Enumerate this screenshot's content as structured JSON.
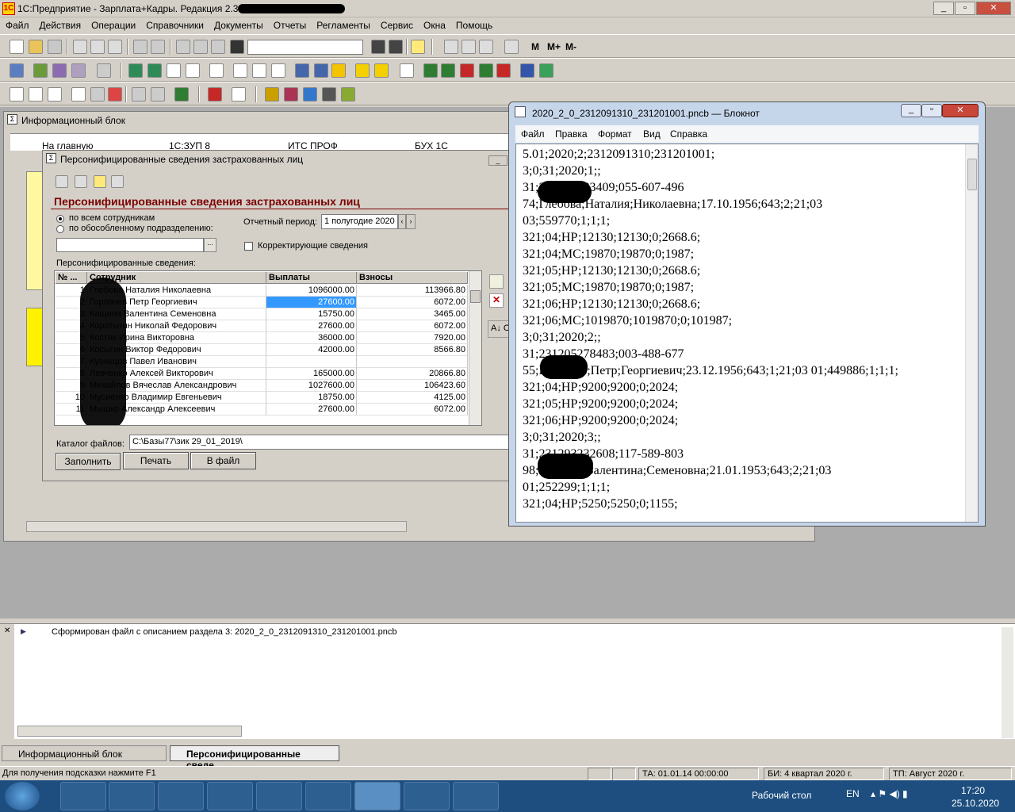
{
  "app": {
    "title": "1С:Предприятие - Зарплата+Кадры. Редакция 2.3: МР"
  },
  "menu": [
    "Файл",
    "Действия",
    "Операции",
    "Справочники",
    "Документы",
    "Отчеты",
    "Регламенты",
    "Сервис",
    "Окна",
    "Помощь"
  ],
  "toolbar": {
    "m1": "М",
    "m2": "М+",
    "m3": "М-"
  },
  "infoblock": {
    "title": "Информационный блок",
    "tabs": [
      "На главную",
      "1С:ЗУП 8",
      "ИТС ПРОФ",
      "БУХ 1С"
    ]
  },
  "form": {
    "title": "Персонифицированные сведения застрахованных лиц",
    "heading": "Персонифицированные сведения застрахованных лиц",
    "radio_all": "по всем сотрудникам",
    "radio_sub": "по обособленному подразделению:",
    "period_label": "Отчетный период:",
    "period_value": "1 полугодие 2020",
    "corr_label": "Корректирующие сведения",
    "list_label": "Персонифицированные сведения:",
    "columns": [
      "№ ...",
      "Сотрудник",
      "Выплаты",
      "Взносы"
    ],
    "rows": [
      {
        "n": "1",
        "name": "Глебова Наталия Николаевна",
        "pay": "1096000.00",
        "contrib": "113966.80"
      },
      {
        "n": "2",
        "name": "Горлачев Петр Георгиевич",
        "pay": "27600.00",
        "contrib": "6072.00"
      },
      {
        "n": "3",
        "name": "Кащина Валентина Семеновна",
        "pay": "15750.00",
        "contrib": "3465.00"
      },
      {
        "n": "4",
        "name": "Коротыгин Николай Федорович",
        "pay": "27600.00",
        "contrib": "6072.00"
      },
      {
        "n": "5",
        "name": "Костяк Ирина Викторовна",
        "pay": "36000.00",
        "contrib": "7920.00"
      },
      {
        "n": "6",
        "name": "Косыгин Виктор Федорович",
        "pay": "42000.00",
        "contrib": "8566.80"
      },
      {
        "n": "7",
        "name": "Кузнецов Павел Иванович",
        "pay": "",
        "contrib": ""
      },
      {
        "n": "8",
        "name": "Левченко Алексей Викторович",
        "pay": "165000.00",
        "contrib": "20866.80"
      },
      {
        "n": "9",
        "name": "Михайлов Вячеслав Александрович",
        "pay": "1027600.00",
        "contrib": "106423.60"
      },
      {
        "n": "10",
        "name": "Мусиенко Владимир Евгеньевич",
        "pay": "18750.00",
        "contrib": "4125.00"
      },
      {
        "n": "11",
        "name": "Мышко Александр Алексеевич",
        "pay": "27600.00",
        "contrib": "6072.00"
      }
    ],
    "catalog_label": "Каталог файлов:",
    "catalog_value": "C:\\Базы77\\зик 29_01_2019\\",
    "btn_fill": "Заполнить",
    "btn_print": "Печать",
    "btn_file": "В файл",
    "side_btn": "О"
  },
  "notepad": {
    "title": "2020_2_0_2312091310_231201001.pncb — Блокнот",
    "menu": [
      "Файл",
      "Правка",
      "Формат",
      "Вид",
      "Справка"
    ],
    "lines": [
      "5.01;2020;2;2312091310;231201001;",
      "3;0;31;2020;1;;",
      "31;231208183409;055-607-496",
      "74;Глебова;Наталия;Николаевна;17.10.1956;643;2;21;03",
      "03;559770;1;1;1;",
      "321;04;НР;12130;12130;0;2668.6;",
      "321;04;МС;19870;19870;0;1987;",
      "321;05;НР;12130;12130;0;2668.6;",
      "321;05;МС;19870;19870;0;1987;",
      "321;06;НР;12130;12130;0;2668.6;",
      "321;06;МС;1019870;1019870;0;101987;",
      "3;0;31;2020;2;;",
      "31;231205278483;003-488-677",
      "55;Горлачев;Петр;Георгиевич;23.12.1956;643;1;21;03 01;449886;1;1;1;",
      "321;04;НР;9200;9200;0;2024;",
      "321;05;НР;9200;9200;0;2024;",
      "321;06;НР;9200;9200;0;2024;",
      "3;0;31;2020;3;;",
      "31;231293232608;117-589-803",
      "98;Кащина;Валентина;Семеновна;21.01.1953;643;2;21;03",
      "01;252299;1;1;1;",
      "321;04;НР;5250;5250;0;1155;"
    ]
  },
  "messages": [
    "Сформирован файл с описанием раздела 3: 2020_2_0_2312091310_231201001.pncb"
  ],
  "windowbar": [
    "Информационный блок",
    "Персонифицированные сведе..."
  ],
  "status": {
    "hint": "Для получения подсказки нажмите F1",
    "ta": "ТА: 01.01.14  00:00:00",
    "bi": "БИ: 4 квартал 2020 г.",
    "tp": "ТП: Август 2020 г."
  },
  "taskbar": {
    "desktop": "Рабочий стол",
    "lang": "EN",
    "time": "17:20",
    "date": "25.10.2020"
  },
  "colors": {
    "accent_heading": "#7b0000",
    "selected_cell": "#3399ff",
    "taskbar": "#1d4e7f",
    "yellow_panel": "#fff200"
  }
}
